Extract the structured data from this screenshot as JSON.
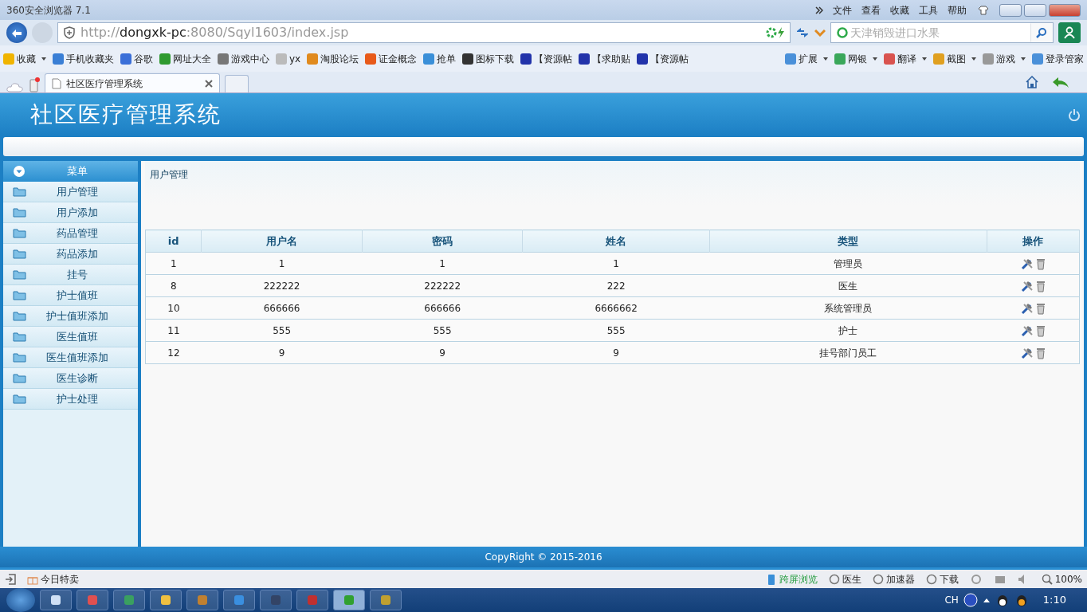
{
  "browser": {
    "title": "360安全浏览器 7.1",
    "menu": [
      "文件",
      "查看",
      "收藏",
      "工具",
      "帮助"
    ],
    "url": {
      "scheme": "http://",
      "host": "dongxk-pc",
      "rest": ":8080/Sqyl1603/index.jsp"
    },
    "search": {
      "placeholder": "天津销毁进口水果"
    },
    "bookmarks": [
      {
        "label": "收藏",
        "dropdown": true,
        "color": "#f0b400"
      },
      {
        "label": "手机收藏夹",
        "dropdown": false,
        "color": "#3a7fd5"
      },
      {
        "label": "谷歌",
        "dropdown": false,
        "color": "#3a6fd8"
      },
      {
        "label": "网址大全",
        "dropdown": false,
        "color": "#2f9a2f"
      },
      {
        "label": "游戏中心",
        "dropdown": false,
        "color": "#777777"
      },
      {
        "label": "yx",
        "dropdown": false,
        "color": "#bbbbbb"
      },
      {
        "label": "淘股论坛",
        "dropdown": false,
        "color": "#e08a1e"
      },
      {
        "label": "证金概念",
        "dropdown": false,
        "color": "#e85a1a"
      },
      {
        "label": "抢单",
        "dropdown": false,
        "color": "#3a8fd8"
      },
      {
        "label": "图标下载",
        "dropdown": false,
        "color": "#333333"
      },
      {
        "label": "【资源帖",
        "dropdown": false,
        "color": "#2233aa"
      },
      {
        "label": "【求助贴",
        "dropdown": false,
        "color": "#2233aa"
      },
      {
        "label": "【资源帖",
        "dropdown": false,
        "color": "#2233aa"
      }
    ],
    "extensions": [
      {
        "label": "扩展",
        "dropdown": true,
        "color": "#4a90d9"
      },
      {
        "label": "网银",
        "dropdown": true,
        "color": "#3aa75a"
      },
      {
        "label": "翻译",
        "dropdown": true,
        "color": "#d9534f"
      },
      {
        "label": "截图",
        "dropdown": true,
        "color": "#e0a020"
      },
      {
        "label": "游戏",
        "dropdown": true,
        "color": "#999999"
      },
      {
        "label": "登录管家",
        "dropdown": false,
        "color": "#4a90d9"
      }
    ],
    "tabs": [
      {
        "label": "社区医疗管理系统",
        "selected": true
      }
    ]
  },
  "app": {
    "title": "社区医疗管理系统",
    "menu_title": "菜单",
    "menu": [
      {
        "label": "用户管理",
        "selected": false
      },
      {
        "label": "用户添加",
        "selected": false
      },
      {
        "label": "药品管理",
        "selected": false
      },
      {
        "label": "药品添加",
        "selected": false
      },
      {
        "label": "挂号",
        "selected": false
      },
      {
        "label": "护士值班",
        "selected": false
      },
      {
        "label": "护士值班添加",
        "selected": false
      },
      {
        "label": "医生值班",
        "selected": false
      },
      {
        "label": "医生值班添加",
        "selected": false
      },
      {
        "label": "医生诊断",
        "selected": false
      },
      {
        "label": "护士处理",
        "selected": false
      }
    ],
    "breadcrumb": "用户管理",
    "table": {
      "columns": [
        "id",
        "用户名",
        "密码",
        "姓名",
        "类型",
        "操作"
      ],
      "rows": [
        [
          "1",
          "1",
          "1",
          "1",
          "管理员"
        ],
        [
          "8",
          "222222",
          "222222",
          "222",
          "医生"
        ],
        [
          "10",
          "666666",
          "666666",
          "6666662",
          "系统管理员"
        ],
        [
          "11",
          "555",
          "555",
          "555",
          "护士"
        ],
        [
          "12",
          "9",
          "9",
          "9",
          "挂号部门员工"
        ]
      ]
    },
    "footer": "CopyRight © 2015-2016"
  },
  "status_bar": {
    "left": [
      "今日特卖"
    ],
    "right": [
      {
        "label": "跨屏浏览",
        "kind": "green"
      },
      {
        "label": "医生",
        "kind": "plain"
      },
      {
        "label": "加速器",
        "kind": "plain"
      },
      {
        "label": "下载",
        "kind": "plain"
      }
    ],
    "zoom": "100%"
  },
  "taskbar": {
    "apps": [
      {
        "selected": false
      },
      {
        "selected": false
      },
      {
        "selected": false
      },
      {
        "selected": false
      },
      {
        "selected": false
      },
      {
        "selected": false
      },
      {
        "selected": false
      },
      {
        "selected": false
      },
      {
        "selected": true
      },
      {
        "selected": false
      }
    ],
    "language": "CH",
    "clock": "1:10"
  }
}
